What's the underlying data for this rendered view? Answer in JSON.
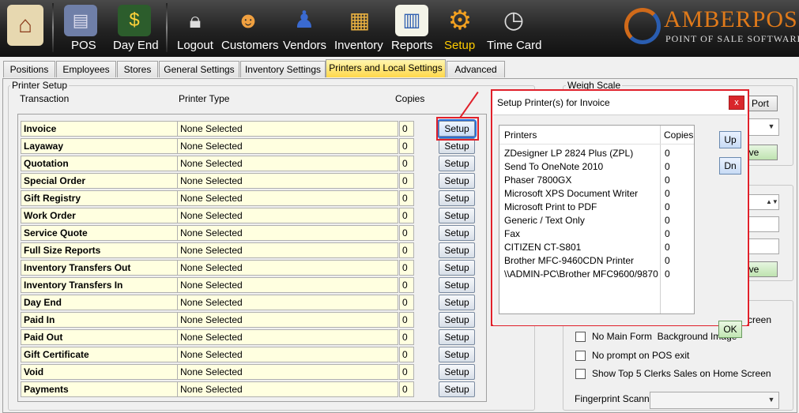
{
  "toolbar": {
    "items": [
      {
        "label": "",
        "icon": "home-icon"
      },
      {
        "label": "POS",
        "icon": "pos-terminal-icon"
      },
      {
        "label": "Day End",
        "icon": "cash-register-icon"
      },
      {
        "label": "Logout",
        "icon": "lock-icon"
      },
      {
        "label": "Customers",
        "icon": "customers-icon"
      },
      {
        "label": "Vendors",
        "icon": "vendor-icon"
      },
      {
        "label": "Inventory",
        "icon": "inventory-icon"
      },
      {
        "label": "Reports",
        "icon": "reports-icon"
      },
      {
        "label": "Setup",
        "icon": "gear-icon"
      },
      {
        "label": "Time Card",
        "icon": "clock-icon"
      }
    ],
    "active": "Setup"
  },
  "logo": {
    "brand_amber": "AMBER",
    "brand_pos": "POS",
    "tagline": "POINT OF SALE SOFTWARE"
  },
  "tabs": [
    "Positions",
    "Employees",
    "Stores",
    "General Settings",
    "Inventory Settings",
    "Printers and Local Settings",
    "Advanced"
  ],
  "active_tab": "Printers and Local Settings",
  "printer_setup": {
    "group_title": "Printer Setup",
    "headers": {
      "transaction": "Transaction",
      "printer_type": "Printer Type",
      "copies": "Copies"
    },
    "rows": [
      {
        "name": "Invoice",
        "printer": "None Selected",
        "copies": "0",
        "button": "Setup"
      },
      {
        "name": "Layaway",
        "printer": "None Selected",
        "copies": "0",
        "button": "Setup"
      },
      {
        "name": "Quotation",
        "printer": "None Selected",
        "copies": "0",
        "button": "Setup"
      },
      {
        "name": "Special Order",
        "printer": "None Selected",
        "copies": "0",
        "button": "Setup"
      },
      {
        "name": "Gift Registry",
        "printer": "None Selected",
        "copies": "0",
        "button": "Setup"
      },
      {
        "name": "Work Order",
        "printer": "None Selected",
        "copies": "0",
        "button": "Setup"
      },
      {
        "name": "Service Quote",
        "printer": "None Selected",
        "copies": "0",
        "button": "Setup"
      },
      {
        "name": "Full Size Reports",
        "printer": "None Selected",
        "copies": "0",
        "button": "Setup"
      },
      {
        "name": "Inventory Transfers Out",
        "printer": "None Selected",
        "copies": "0",
        "button": "Setup"
      },
      {
        "name": "Inventory Transfers In",
        "printer": "None Selected",
        "copies": "0",
        "button": "Setup"
      },
      {
        "name": "Day End",
        "printer": "None Selected",
        "copies": "0",
        "button": "Setup"
      },
      {
        "name": "Paid In",
        "printer": "None Selected",
        "copies": "0",
        "button": "Setup"
      },
      {
        "name": "Paid Out",
        "printer": "None Selected",
        "copies": "0",
        "button": "Setup"
      },
      {
        "name": "Gift Certificate",
        "printer": "None Selected",
        "copies": "0",
        "button": "Setup"
      },
      {
        "name": "Void",
        "printer": "None Selected",
        "copies": "0",
        "button": "Setup"
      },
      {
        "name": "Payments",
        "printer": "None Selected",
        "copies": "0",
        "button": "Setup"
      }
    ]
  },
  "weigh_scale": {
    "title": "Weigh Scale",
    "port_btn": "Port",
    "save_btn": "ave"
  },
  "second_panel": {
    "save_btn": "ave"
  },
  "misc": {
    "clipped_text": "creen",
    "checkboxes": [
      "No Main Form  Background Image",
      "No prompt on POS exit",
      "Show Top 5 Clerks Sales on Home Screen"
    ],
    "fingerprint_label": "Fingerprint Scanner:"
  },
  "dialog": {
    "title": "Setup Printer(s) for Invoice",
    "close": "x",
    "col_printers": "Printers",
    "col_copies": "Copies",
    "printers": [
      {
        "name": "ZDesigner LP 2824 Plus (ZPL)",
        "copies": "0"
      },
      {
        "name": "Send To OneNote 2010",
        "copies": "0"
      },
      {
        "name": "Phaser 7800GX",
        "copies": "0"
      },
      {
        "name": "Microsoft XPS Document Writer",
        "copies": "0"
      },
      {
        "name": "Microsoft Print to PDF",
        "copies": "0"
      },
      {
        "name": "Generic / Text Only",
        "copies": "0"
      },
      {
        "name": "Fax",
        "copies": "0"
      },
      {
        "name": "CITIZEN CT-S801",
        "copies": "0"
      },
      {
        "name": "Brother MFC-9460CDN Printer",
        "copies": "0"
      },
      {
        "name": "\\\\ADMIN-PC\\Brother MFC9600/9870 ...",
        "copies": "0"
      }
    ],
    "up": "Up",
    "dn": "Dn",
    "ok": "OK"
  },
  "colors": {
    "highlight": "#e0202a",
    "row_bg": "#ffffe0",
    "active_tab": "#ffd84a"
  }
}
